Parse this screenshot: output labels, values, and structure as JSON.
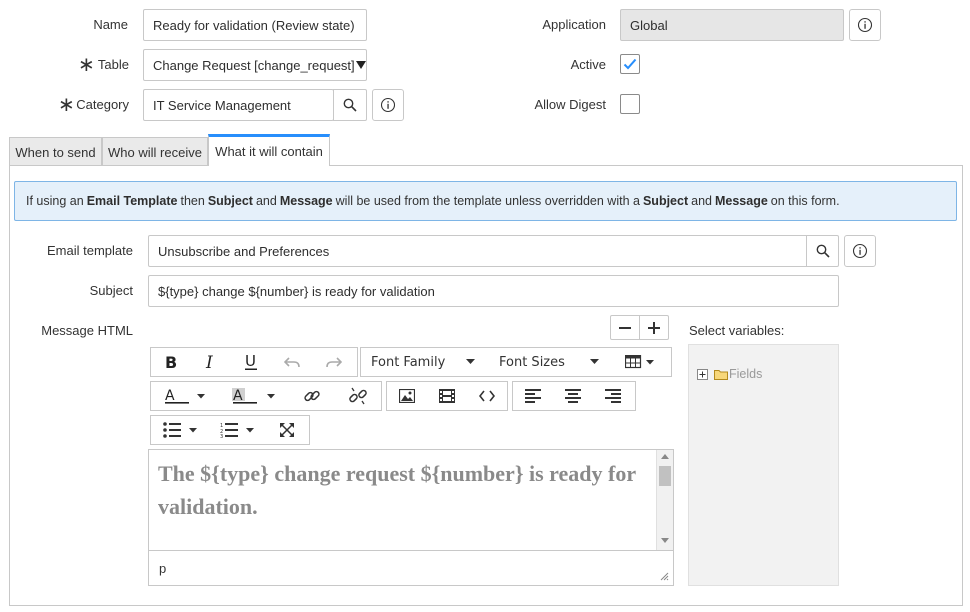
{
  "form": {
    "name_label": "Name",
    "name_value": "Ready for validation (Review state)",
    "table_label": "Table",
    "table_value": "Change Request [change_request]",
    "category_label": "Category",
    "category_value": "IT Service Management",
    "application_label": "Application",
    "application_value": "Global",
    "active_label": "Active",
    "active_checked": true,
    "allow_digest_label": "Allow Digest",
    "allow_digest_checked": false,
    "required_mark": "∗"
  },
  "tabs": [
    {
      "label": "When to send",
      "active": false
    },
    {
      "label": "Who will receive",
      "active": false
    },
    {
      "label": "What it will contain",
      "active": true
    }
  ],
  "info": {
    "t1": "If using an",
    "b1": "Email Template",
    "t2": "then",
    "b2": "Subject",
    "t3": "and",
    "b3": "Message",
    "t4": "will be used from the template unless overridden with a",
    "b4": "Subject",
    "t5": "and",
    "b5": "Message",
    "t6": "on this form."
  },
  "content": {
    "email_template_label": "Email template",
    "email_template_value": "Unsubscribe and Preferences",
    "subject_label": "Subject",
    "subject_value": "${type} change ${number} is ready for validation",
    "message_label": "Message HTML",
    "select_vars_label": "Select variables:",
    "vars_tree_item": "Fields"
  },
  "editor": {
    "font_family": "Font Family",
    "font_sizes": "Font Sizes",
    "body_text": "The ${type} change request ${number} is ready for validation.",
    "status_path": "p"
  },
  "colors": {
    "accent": "#278efc",
    "info_bg": "#e5f0fa",
    "info_border": "#7eb5e6",
    "check": "#278efc"
  }
}
